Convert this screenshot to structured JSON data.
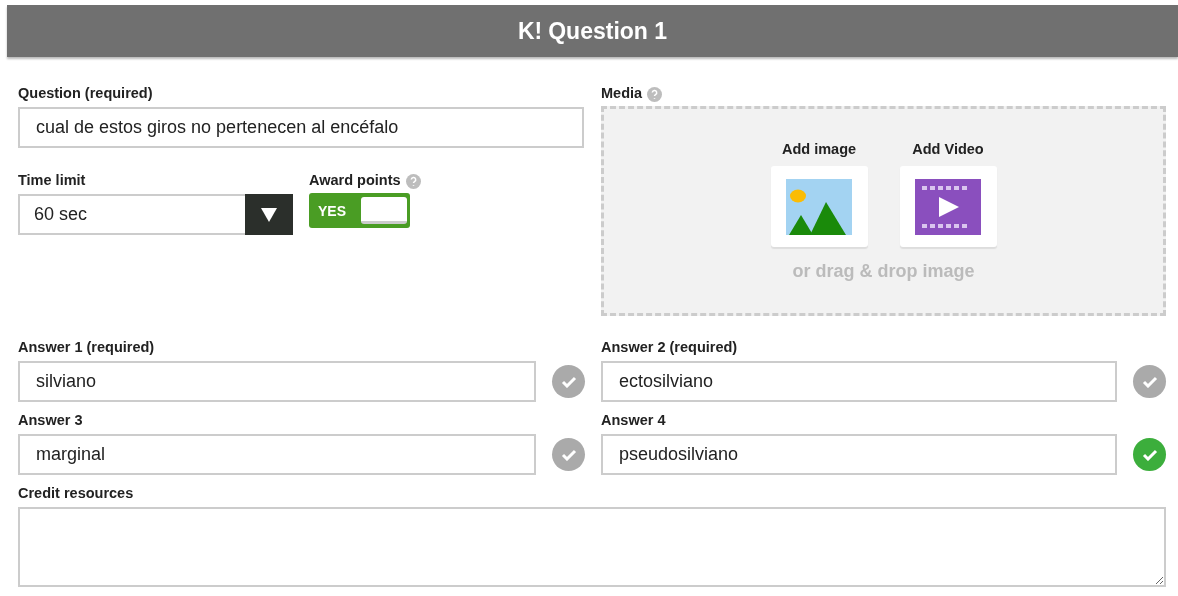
{
  "header": {
    "logo": "K!",
    "title": "Question 1"
  },
  "question": {
    "label": "Question (required)",
    "value": "cual de estos giros no pertenecen al encéfalo"
  },
  "time_limit": {
    "label": "Time limit",
    "value": "60 sec"
  },
  "award_points": {
    "label": "Award points",
    "on": true,
    "toggle_text": "YES"
  },
  "media": {
    "label": "Media",
    "add_image": "Add image",
    "add_video": "Add Video",
    "drop_hint": "or drag & drop image"
  },
  "answers": [
    {
      "label": "Answer 1 (required)",
      "value": "silviano",
      "correct": false
    },
    {
      "label": "Answer 2 (required)",
      "value": "ectosilviano",
      "correct": false
    },
    {
      "label": "Answer 3",
      "value": "marginal",
      "correct": false
    },
    {
      "label": "Answer 4",
      "value": "pseudosilviano",
      "correct": true
    }
  ],
  "credit": {
    "label": "Credit resources"
  }
}
